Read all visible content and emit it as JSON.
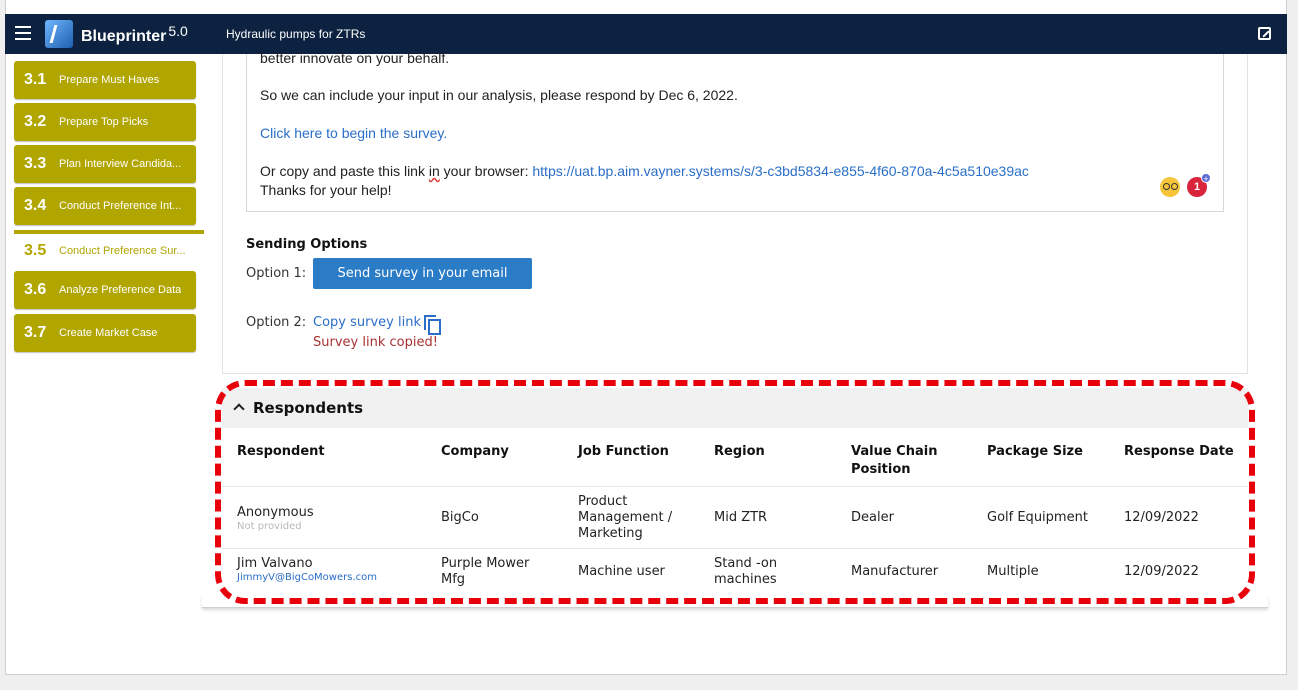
{
  "app": {
    "brand": "Blueprinter",
    "version": "5.0",
    "project_title": "Hydraulic pumps for ZTRs"
  },
  "sidebar": {
    "steps": [
      {
        "num": "3.1",
        "label": "Prepare Must Haves"
      },
      {
        "num": "3.2",
        "label": "Prepare Top Picks"
      },
      {
        "num": "3.3",
        "label": "Plan Interview Candida..."
      },
      {
        "num": "3.4",
        "label": "Conduct Preference Int..."
      },
      {
        "num": "3.5",
        "label": "Conduct Preference Sur..."
      },
      {
        "num": "3.6",
        "label": "Analyze Preference Data"
      },
      {
        "num": "3.7",
        "label": "Create Market Case"
      }
    ],
    "active": "3.5"
  },
  "email": {
    "line_top": "better innovate on your behalf.",
    "line_respond": "So we can include your input in our analysis, please respond by Dec 6, 2022.",
    "begin_link": "Click here to begin the survey.",
    "copy_prefix": "Or copy and paste this link ",
    "copy_in": "in",
    "copy_mid": " your browser: ",
    "survey_url": "https://uat.bp.aim.vayner.systems/s/3-c3bd5834-e855-4f60-870a-4c5a510e39ac",
    "thanks": "Thanks for your help!",
    "badge_count": "1",
    "badge_plus": "+"
  },
  "sending": {
    "title": "Sending Options",
    "option1_label": "Option 1:",
    "send_button": "Send survey in your email",
    "option2_label": "Option 2:",
    "copy_link": "Copy survey link",
    "copied_msg": "Survey link copied!"
  },
  "respondents": {
    "title": "Respondents",
    "columns": [
      "Respondent",
      "Company",
      "Job Function",
      "Region",
      "Value Chain Position",
      "Package Size",
      "Response Date"
    ],
    "rows": [
      {
        "name": "Anonymous",
        "sub": "Not provided",
        "company": "BigCo",
        "job_function": "Product Management / Marketing",
        "region": "Mid ZTR",
        "value_chain": "Dealer",
        "package": "Golf Equipment",
        "date": "12/09/2022"
      },
      {
        "name": "Jim Valvano",
        "sub": "JimmyV@BigCoMowers.com",
        "company": "Purple Mower Mfg",
        "job_function": "Machine user",
        "region": "Stand -on machines",
        "value_chain": "Manufacturer",
        "package": "Multiple",
        "date": "12/09/2022"
      }
    ]
  }
}
